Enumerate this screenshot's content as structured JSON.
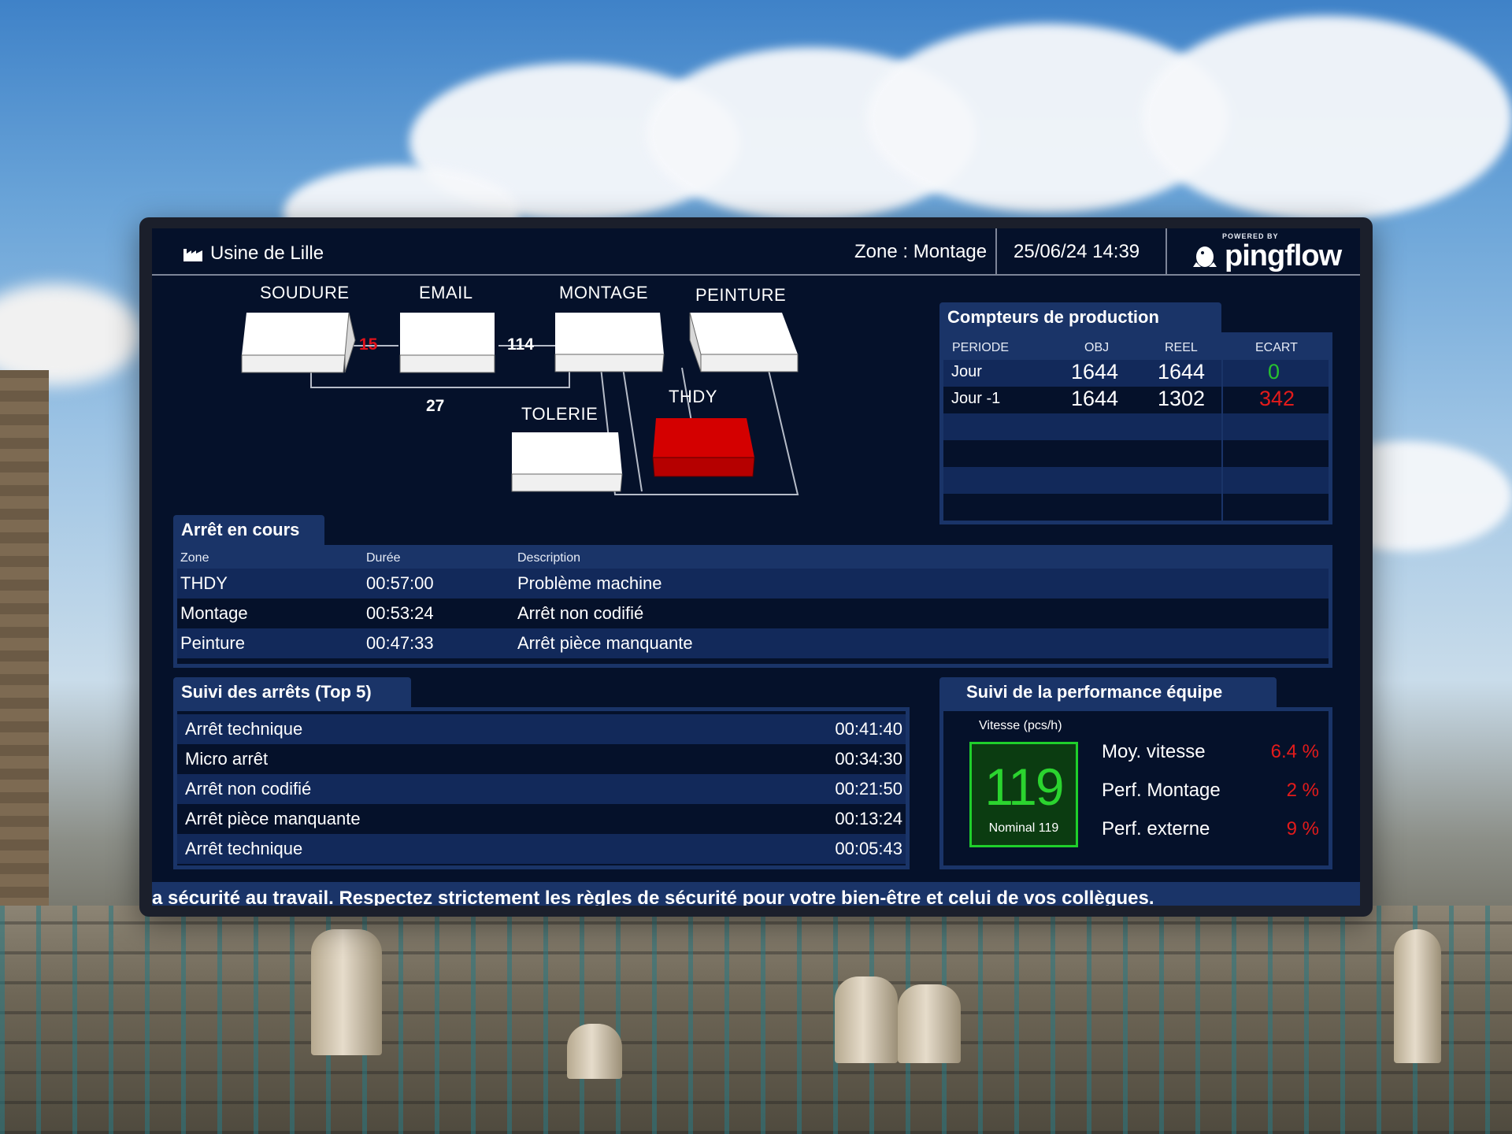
{
  "header": {
    "site_name": "Usine de Lille",
    "zone": "Zone : Montage",
    "datetime": "25/06/24 14:39",
    "powered_by": "POWERED BY",
    "brand": "pingflow"
  },
  "flow": {
    "stations": {
      "soudure": "SOUDURE",
      "email": "EMAIL",
      "montage": "MONTAGE",
      "peinture": "PEINTURE",
      "tolerie": "TOLERIE",
      "thdy": "THDY"
    },
    "counts": {
      "soudure_email": "15",
      "email_montage": "114",
      "soudure_montage_loop": "27"
    },
    "colors": {
      "normal": "#ffffff",
      "alert": "#d40000",
      "alert_count": "#e0121b"
    }
  },
  "production": {
    "title": "Compteurs de production",
    "headers": {
      "period": "PERIODE",
      "obj": "OBJ",
      "reel": "REEL",
      "ecart": "ECART"
    },
    "rows": [
      {
        "period": "Jour",
        "obj": "1644",
        "reel": "1644",
        "ecart": "0",
        "ecart_color": "#27c22f"
      },
      {
        "period": "Jour -1",
        "obj": "1644",
        "reel": "1302",
        "ecart": "342",
        "ecart_color": "#e31b1b"
      }
    ]
  },
  "current_stops": {
    "title": "Arrêt en cours",
    "headers": {
      "zone": "Zone",
      "duration": "Durée",
      "description": "Description"
    },
    "rows": [
      {
        "zone": "THDY",
        "duration": "00:57:00",
        "description": "Problème machine"
      },
      {
        "zone": "Montage",
        "duration": "00:53:24",
        "description": "Arrêt non codifié"
      },
      {
        "zone": "Peinture",
        "duration": "00:47:33",
        "description": "Arrêt pièce manquante"
      }
    ]
  },
  "top_stops": {
    "title": "Suivi des arrêts (Top 5)",
    "rows": [
      {
        "label": "Arrêt technique",
        "duration": "00:41:40"
      },
      {
        "label": "Micro arrêt",
        "duration": "00:34:30"
      },
      {
        "label": "Arrêt non codifié",
        "duration": "00:21:50"
      },
      {
        "label": "Arrêt pièce manquante",
        "duration": "00:13:24"
      },
      {
        "label": "Arrêt technique",
        "duration": "00:05:43"
      }
    ]
  },
  "performance": {
    "title": "Suivi de la performance équipe",
    "speed_caption": "Vitesse (pcs/h)",
    "speed_value": "119",
    "speed_nominal": "Nominal 119",
    "items": [
      {
        "label": "Moy. vitesse",
        "value": "6.4 %"
      },
      {
        "label": "Perf. Montage",
        "value": "2 %"
      },
      {
        "label": "Perf. externe",
        "value": "9 %"
      }
    ],
    "value_color": "#e31b1b",
    "speed_color": "#2bd42f"
  },
  "ticker": {
    "text": "a sécurité au travail. Respectez strictement les règles de sécurité pour votre bien-être et celui de vos collègues."
  }
}
